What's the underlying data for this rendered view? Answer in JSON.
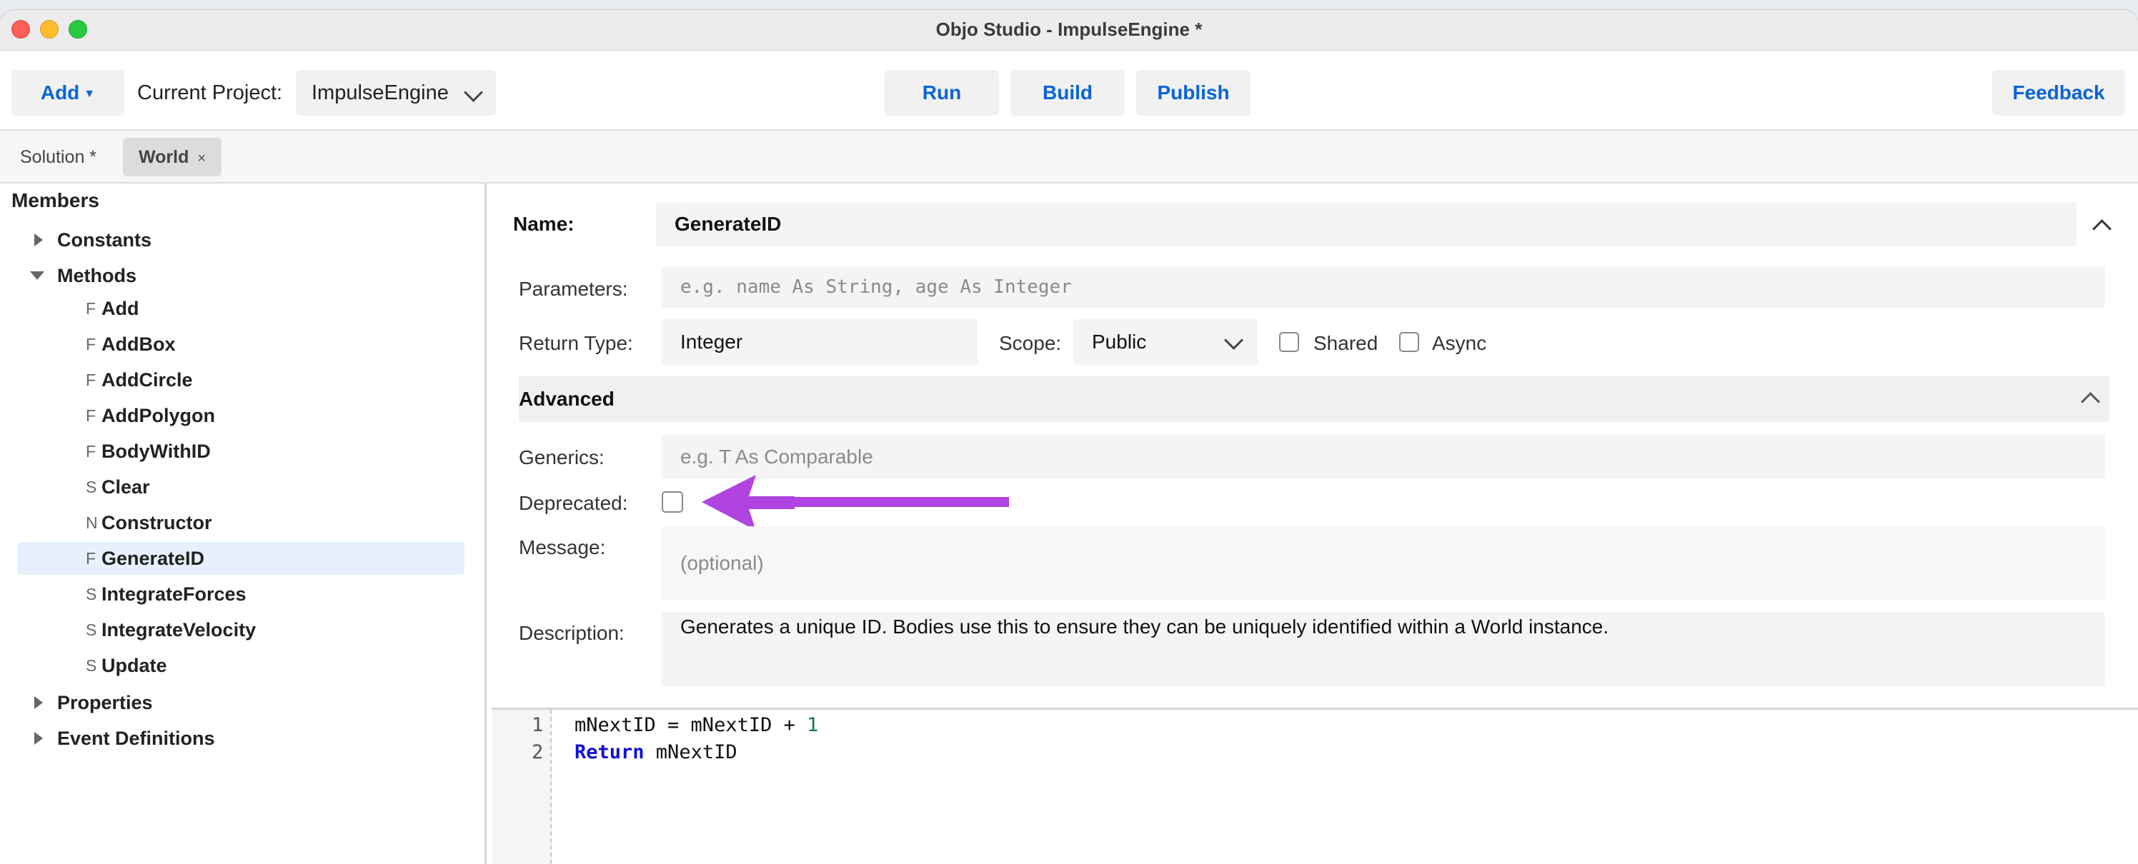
{
  "window": {
    "title": "Objo Studio - ImpulseEngine *"
  },
  "toolbar": {
    "add_label": "Add",
    "current_project_label": "Current Project:",
    "project_value": "ImpulseEngine",
    "run_label": "Run",
    "build_label": "Build",
    "publish_label": "Publish",
    "feedback_label": "Feedback"
  },
  "tabs": [
    {
      "label": "Solution *"
    },
    {
      "label": "World"
    }
  ],
  "sidebar": {
    "title": "Members",
    "groups": {
      "constants": "Constants",
      "methods": "Methods",
      "properties": "Properties",
      "event_definitions": "Event Definitions"
    },
    "methods": [
      {
        "kind": "F",
        "name": "Add"
      },
      {
        "kind": "F",
        "name": "AddBox"
      },
      {
        "kind": "F",
        "name": "AddCircle"
      },
      {
        "kind": "F",
        "name": "AddPolygon"
      },
      {
        "kind": "F",
        "name": "BodyWithID"
      },
      {
        "kind": "S",
        "name": "Clear"
      },
      {
        "kind": "N",
        "name": "Constructor"
      },
      {
        "kind": "F",
        "name": "GenerateID"
      },
      {
        "kind": "S",
        "name": "IntegrateForces"
      },
      {
        "kind": "S",
        "name": "IntegrateVelocity"
      },
      {
        "kind": "S",
        "name": "Update"
      }
    ]
  },
  "editor": {
    "name_label": "Name:",
    "name_value": "GenerateID",
    "parameters_label": "Parameters:",
    "parameters_placeholder": "e.g. name As String, age As Integer",
    "return_type_label": "Return Type:",
    "return_type_value": "Integer",
    "scope_label": "Scope:",
    "scope_value": "Public",
    "shared_label": "Shared",
    "async_label": "Async",
    "advanced_label": "Advanced",
    "generics_label": "Generics:",
    "generics_placeholder": "e.g. T As Comparable",
    "deprecated_label": "Deprecated:",
    "message_label": "Message:",
    "message_placeholder": "(optional)",
    "description_label": "Description:",
    "description_value": "Generates a unique ID. Bodies use this to ensure they can be uniquely identified within a World instance."
  },
  "code": {
    "line_numbers": [
      "1",
      "2"
    ],
    "line1": {
      "a": "mNextID = mNextID + ",
      "num": "1"
    },
    "line2": {
      "kw": "Return",
      "rest": " mNextID"
    }
  },
  "colors": {
    "accent": "#0a64d8",
    "annotation_arrow": "#b044e0",
    "selection": "#e7f1fd"
  }
}
